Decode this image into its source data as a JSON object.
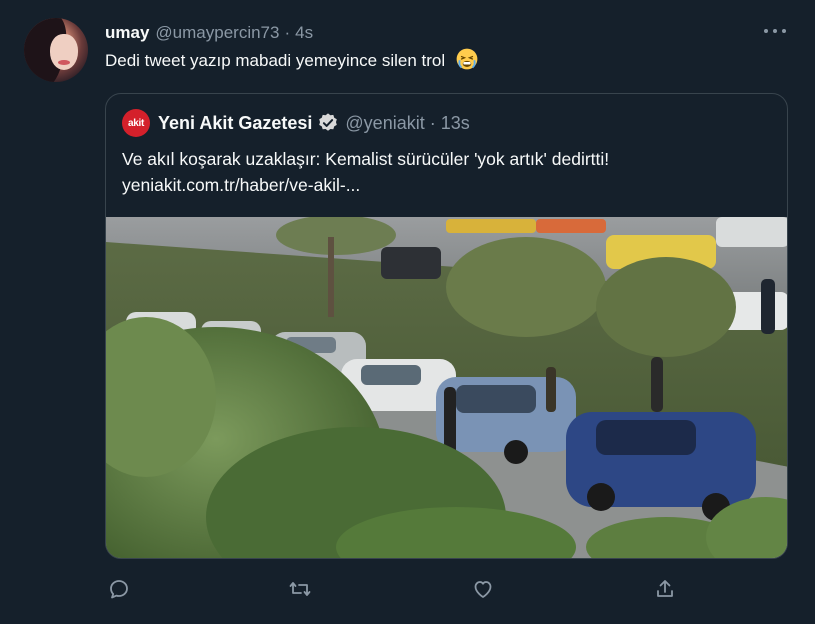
{
  "tweet": {
    "display_name": "umay",
    "handle": "@umaypercin73",
    "separator": "·",
    "time": "4s",
    "text": "Dedi tweet yazıp mabadi yemeyince silen trol",
    "emoji": "weary-face-emoji"
  },
  "quoted": {
    "logo_text": "akit",
    "display_name": "Yeni Akit Gazetesi",
    "handle": "@yeniakit",
    "separator": "·",
    "time": "13s",
    "text": "Ve akıl koşarak uzaklaşır: Kemalist sürücüler 'yok artık' dedirtti!",
    "link": "yeniakit.com.tr/haber/ve-akil-...",
    "media": "photo of a multi-car collision on a road beside grass and trees"
  },
  "actions": [
    "reply-icon",
    "retweet-icon",
    "like-icon",
    "share-icon"
  ],
  "colors": {
    "background": "#15202b",
    "text": "#f7f9f9",
    "secondary": "#8b98a5",
    "border": "#38444d",
    "verified": "#d9d9d9",
    "brand": "#d4202b"
  }
}
